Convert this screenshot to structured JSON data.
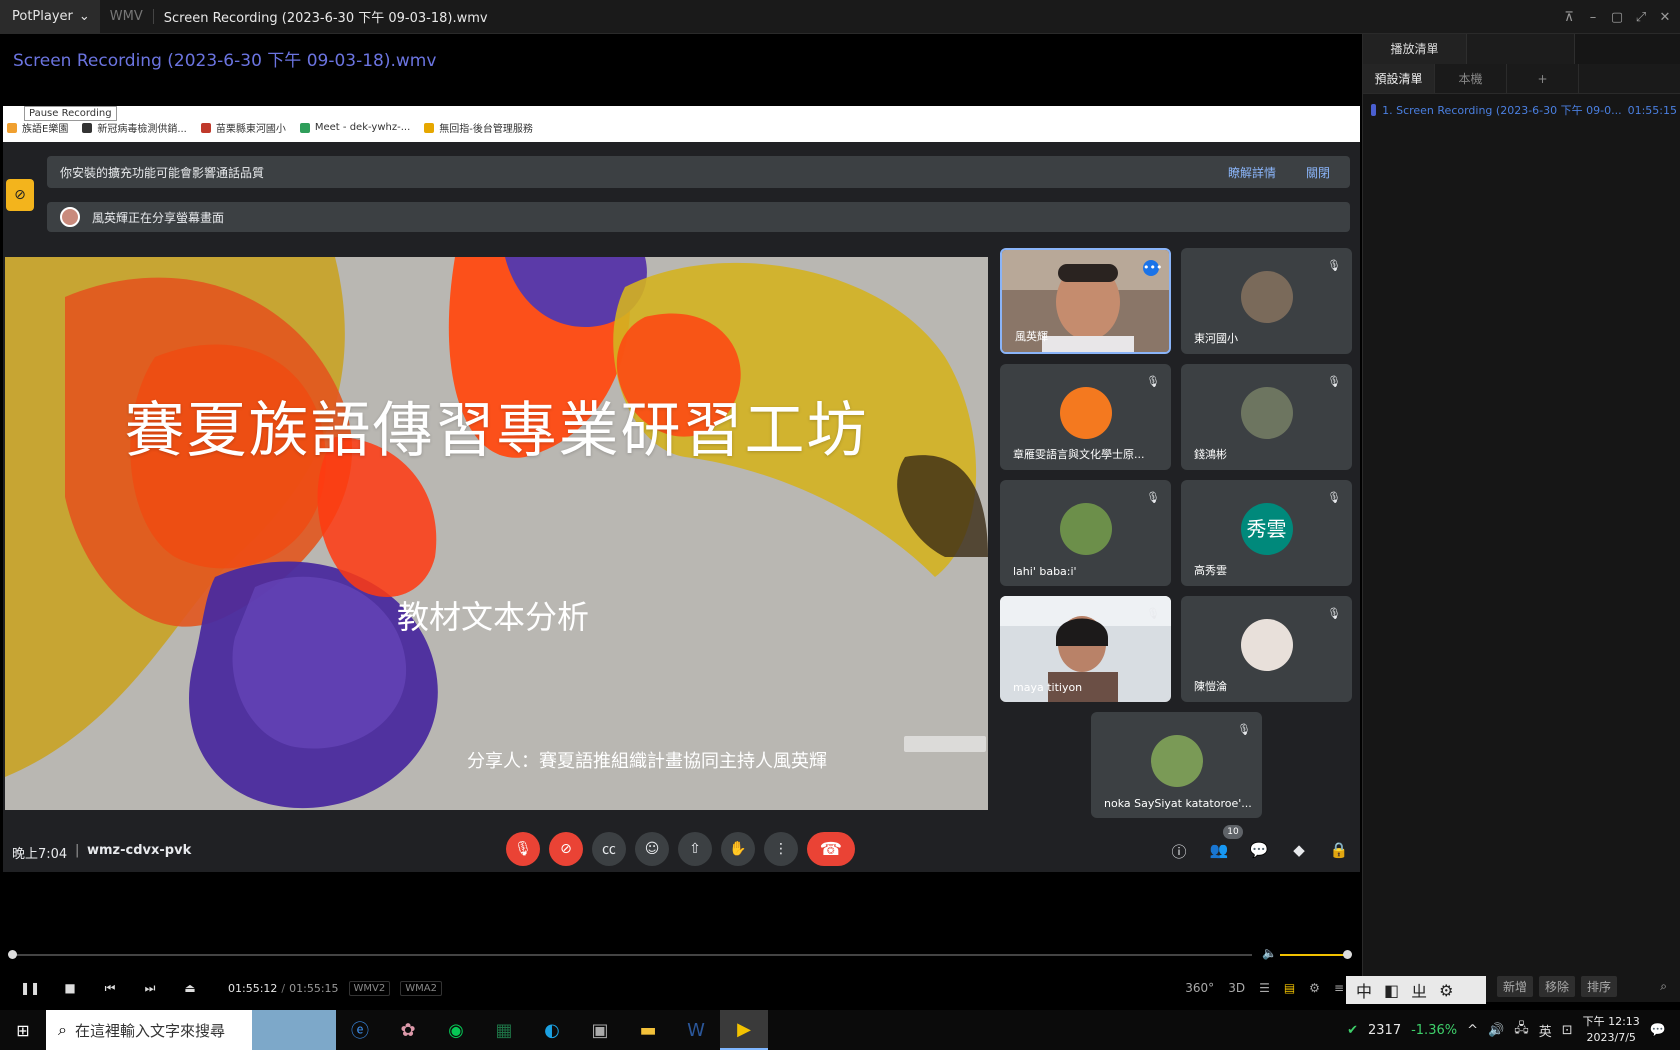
{
  "titlebar": {
    "app": "PotPlayer",
    "format": "WMV",
    "title": "Screen Recording (2023-6-30 下午 09-03-18).wmv"
  },
  "overlay_title": "Screen Recording (2023-6-30 下午 09-03-18).wmv",
  "browser": {
    "tooltip": "Pause Recording",
    "bookmarks": [
      {
        "label": "族語E樂園",
        "color": "#f0a030"
      },
      {
        "label": "新冠病毒檢測供銷...",
        "color": "#333333"
      },
      {
        "label": "苗栗縣東河國小",
        "color": "#c0392b"
      },
      {
        "label": "Meet - dek-ywhz-...",
        "color": "#2f9e5a"
      },
      {
        "label": "無回指-後台管理服務",
        "color": "#e6a700"
      }
    ]
  },
  "meet": {
    "banner1": "你安裝的擴充功能可能會影響通話品質",
    "banner1_link1": "瞭解詳情",
    "banner1_link2": "關閉",
    "banner2": "風英輝正在分享螢幕畫面",
    "slide": {
      "title": "賽夏族語傳習專業研習工坊",
      "subtitle": "教材文本分析",
      "presenter": "分享人：賽夏語推組織計畫協同主持人風英輝"
    },
    "participants": [
      {
        "name": "風英輝"
      },
      {
        "name": "東河國小"
      },
      {
        "name": "章雁雯語言與文化學士原..."
      },
      {
        "name": "錢鴻彬"
      },
      {
        "name": "lahi' baba:i'"
      },
      {
        "name": "高秀雲",
        "initials": "秀雲"
      },
      {
        "name": "maya titiyon"
      },
      {
        "name": "陳愷淪"
      },
      {
        "name": "noka SaySiyat katatoroe'..."
      }
    ],
    "time": "晚上7:04",
    "meeting_code": "wmz-cdvx-pvk",
    "people_count": "10"
  },
  "player": {
    "current_time": "01:55:12",
    "separator": "/",
    "duration": "01:55:15",
    "video_codec": "WMV2",
    "audio_codec": "WMA2",
    "progress": 0.9996,
    "volume": 0.95
  },
  "playlist": {
    "tab_top": "播放清單",
    "tab_default": "預設清單",
    "tab_local": "本機",
    "tab_add": "+",
    "item_title": "1. Screen Recording (2023-6-30 下午 09-0...",
    "item_duration": "01:55:15",
    "btn_add": "新增",
    "btn_remove": "移除",
    "btn_sort": "排序"
  },
  "ime": {
    "mode": "中"
  },
  "taskbar": {
    "search_placeholder": "在這裡輸入文字來搜尋",
    "stock_value": "2317",
    "stock_change": "-1.36%",
    "lang": "英",
    "clock_time": "下午 12:13",
    "clock_date": "2023/7/5"
  }
}
